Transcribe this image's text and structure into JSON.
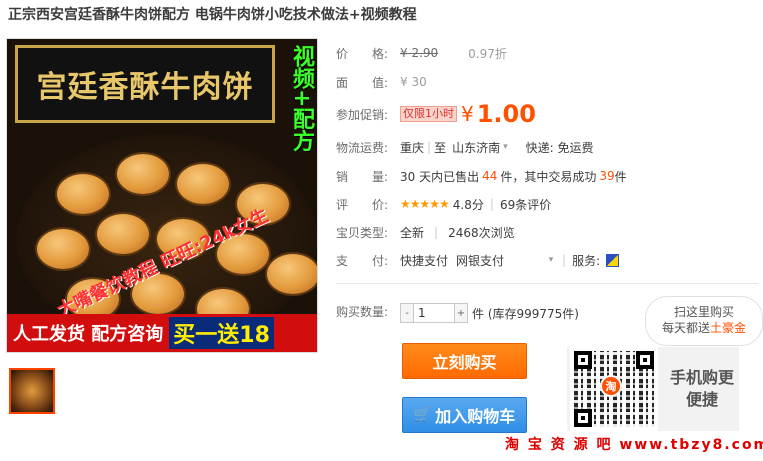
{
  "title": "正宗西安宫廷香酥牛肉饼配方 电锅牛肉饼小吃技术做法+视频教程",
  "image": {
    "sign_text": "宫廷香酥牛肉饼",
    "side_badge": "视频+配方",
    "watermark": "大嘴餐饮教程 旺旺:24k女生",
    "banner_text": "人工发货 配方咨询",
    "banner_highlight": "买一送18"
  },
  "price": {
    "label": "价　　格:",
    "original": "¥ 2.90",
    "discount": "0.97折"
  },
  "face_value": {
    "label": "面　　值:",
    "value": "¥ 30"
  },
  "promo": {
    "label": "参加促销:",
    "tag": "仅限1小时",
    "currency": "¥",
    "price": "1.00"
  },
  "shipping": {
    "label": "物流运费:",
    "from": "重庆",
    "to_label": "至",
    "to": "山东济南",
    "express": "快递: 免运费"
  },
  "sales": {
    "label": "销　　量:",
    "prefix": "30 天内已售出",
    "sold": "44",
    "middle": "件，其中交易成功",
    "success": "39",
    "suffix": "件"
  },
  "rating": {
    "label": "评　　价:",
    "stars": "★★★★★",
    "score": "4.8分",
    "reviews": "69条评价"
  },
  "item_type": {
    "label": "宝贝类型:",
    "value": "全新",
    "views": "2468次浏览"
  },
  "payment": {
    "label": "支　　付:",
    "method1": "快捷支付",
    "method2": "网银支付",
    "service_label": "服务:"
  },
  "quantity": {
    "label": "购买数量:",
    "value": "1",
    "minus": "-",
    "plus": "+",
    "stock": "件 (库存999775件)"
  },
  "buttons": {
    "buy_now": "立刻购买",
    "add_to_cart": "加入购物车"
  },
  "mobile": {
    "bubble_line1": "扫这里购买",
    "bubble_line2_prefix": "每天都送",
    "bubble_line2_highlight": "土豪金",
    "qr_logo": "淘",
    "text": "手机购更便捷"
  },
  "site_watermark": "淘 宝 资 源 吧  www.tbzy8.com"
}
